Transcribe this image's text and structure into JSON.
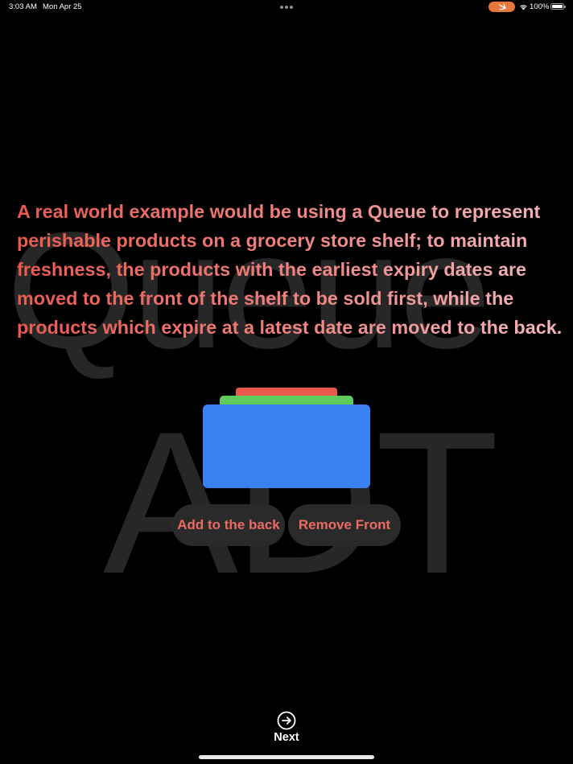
{
  "status_bar": {
    "time": "3:03 AM",
    "date": "Mon Apr 25",
    "battery": "100%",
    "colors": {
      "swift_pill": "#e8773a"
    },
    "icons": [
      "multitask-dots-icon",
      "swift-icon",
      "wifi-icon",
      "battery-icon"
    ]
  },
  "background": {
    "word_top": "Queue",
    "word_bottom": "ADT",
    "color": "#272727"
  },
  "content": {
    "description": "A real world example would be using a Queue to represent perishable products on a grocery store shelf; to maintain freshness, the products with the earliest expiry dates are moved to the front of the shelf to be sold first, while the products which expire at a latest date are moved to the back."
  },
  "queue": {
    "items": [
      {
        "color": "#e9594e",
        "name": "red"
      },
      {
        "color": "#5fcb5c",
        "name": "green"
      },
      {
        "color": "#3b80f3",
        "name": "blue"
      }
    ]
  },
  "actions": {
    "add_label": "Add to the back",
    "remove_label": "Remove Front"
  },
  "navigation": {
    "next_label": "Next",
    "next_icon": "arrow-right-circle-icon"
  },
  "colors": {
    "background": "#000000",
    "accent_text": "#ec6b62",
    "button_bg": "#2a2a2a"
  }
}
